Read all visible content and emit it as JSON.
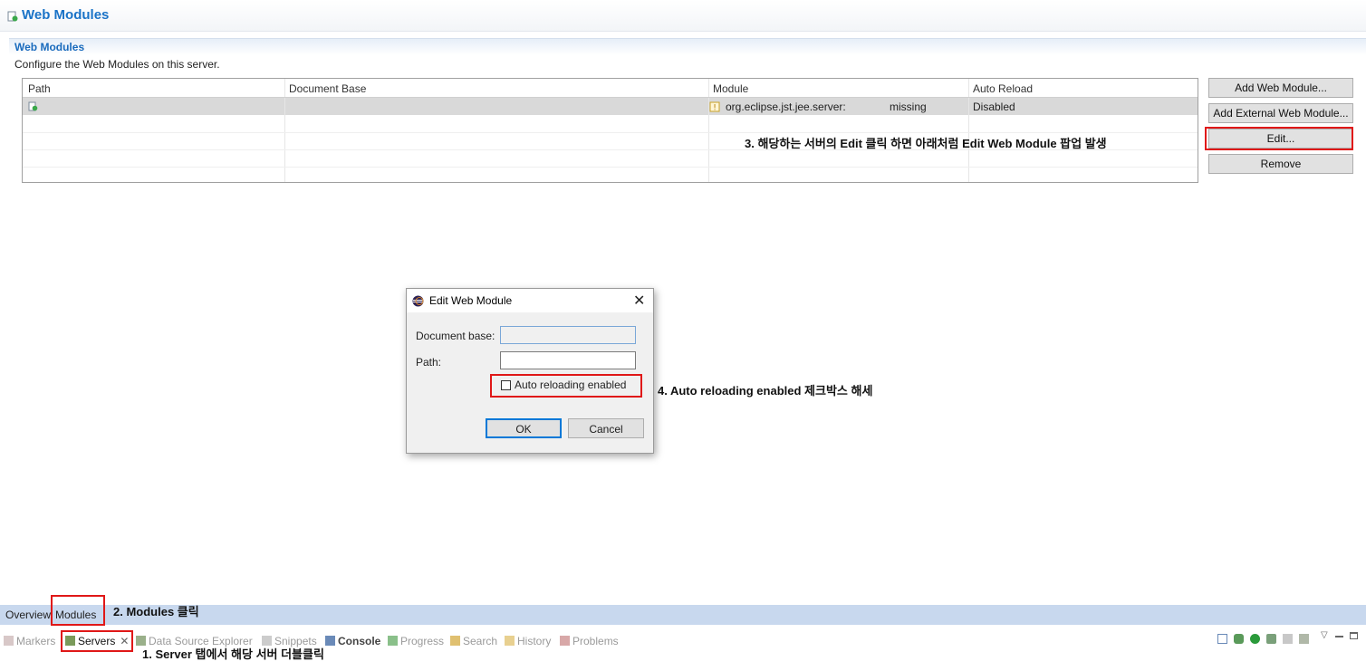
{
  "header": {
    "title": "Web Modules"
  },
  "section": {
    "title": "Web Modules",
    "description": "Configure the Web Modules on this server."
  },
  "table": {
    "columns": [
      "Path",
      "Document Base",
      "Module",
      "Auto Reload"
    ],
    "rows": [
      {
        "path": "",
        "document_base": "",
        "module": "org.eclipse.jst.jee.server:",
        "module_status": "missing",
        "auto_reload": "Disabled"
      }
    ]
  },
  "buttons": {
    "add": "Add Web Module...",
    "add_external": "Add External Web Module...",
    "edit": "Edit...",
    "remove": "Remove"
  },
  "dialog": {
    "title": "Edit Web Module",
    "document_base_label": "Document base:",
    "path_label": "Path:",
    "checkbox_label": "Auto reloading enabled",
    "checkbox_checked": false,
    "ok": "OK",
    "cancel": "Cancel"
  },
  "editor_tabs": [
    "Overview",
    "Modules"
  ],
  "view_tabs": [
    "Markers",
    "Servers",
    "Data Source Explorer",
    "Snippets",
    "Console",
    "Progress",
    "Search",
    "History",
    "Problems"
  ],
  "annotations": {
    "step1": "1. Server 탭에서 해당 서버 더블클릭",
    "step2": "2. Modules 클릭",
    "step3": "3. 해당하는 서버의 Edit 클릭 하면 아래처럼 Edit Web Module 팝업 발생",
    "step4": "4. Auto reloading enabled 제크박스 해세"
  },
  "colors": {
    "title_blue": "#1a73c7",
    "highlight_red": "#e01818",
    "selected_row": "#d9d9d9",
    "tab_bar": "#c8d8ee"
  }
}
